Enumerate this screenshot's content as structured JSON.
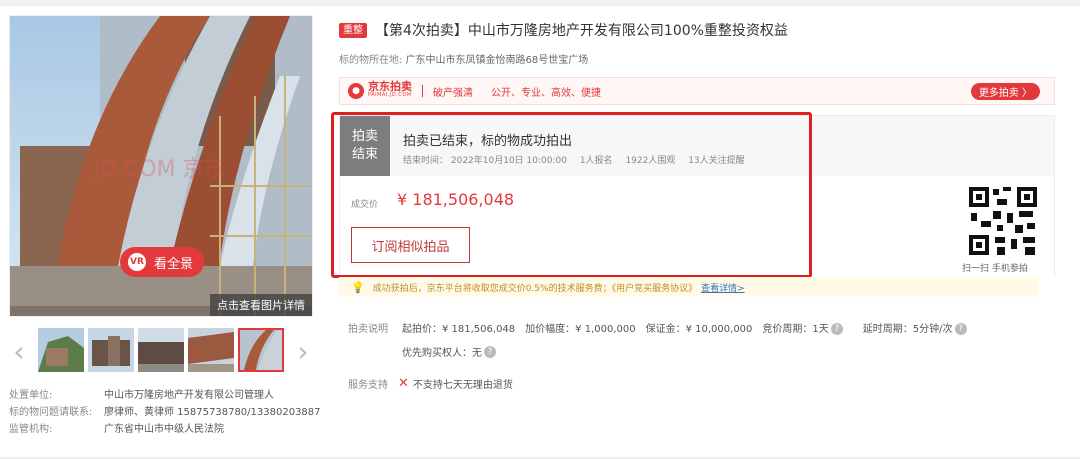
{
  "colors": {
    "accent": "#e4393c",
    "highlight": "#e02020",
    "notice_bg": "#fffbe6",
    "link": "#3a6ec9"
  },
  "gallery": {
    "pano_label": "看全景",
    "pano_icon": "VR",
    "detail_link": "点击查看图片详情",
    "watermark": "JD.COM 京东",
    "prev_icon": "‹",
    "next_icon": "›"
  },
  "org": [
    {
      "key": "处置单位:",
      "value": "中山市万隆房地产开发有限公司管理人"
    },
    {
      "key": "标的物问题请联系:",
      "value": "廖律师、黄律师 15875738780/13380203887"
    },
    {
      "key": "监管机构:",
      "value": "广东省中山市中级人民法院"
    }
  ],
  "header": {
    "badge": "重整",
    "title": "【第4次拍卖】中山市万隆房地产开发有限公司100%重整投资权益",
    "location_label": "标的物所在地:",
    "location_value": "广东中山市东凤镇金怡南路68号世宝广场"
  },
  "brand": {
    "logo_main": "京东拍卖",
    "logo_sub": "PAIMAI.JD.COM",
    "tag": "破产强清",
    "slogan": "公开、专业、高效、便捷",
    "more_label": "更多拍卖 〉"
  },
  "status": {
    "tag_line1": "拍卖",
    "tag_line2": "结束",
    "main": "拍卖已结束，标的物成功拍出",
    "end_time": "结束时间： 2022年10月10日 10:00:00",
    "signups": "1人报名",
    "views": "1922人围观",
    "watchers": "13人关注提醒",
    "price_label": "成交价",
    "price": "¥ 181,506,048",
    "subscribe_label": "订阅相似拍品",
    "qr_caption": "扫一扫 手机参拍"
  },
  "notice": {
    "text": "成功获拍后，京东平台将收取您成交价0.5%的技术服务费；《用户竞买服务协议》",
    "link": "查看详情>"
  },
  "params": {
    "label": "拍卖说明",
    "start_price": "起拍价：¥ 181,506,048",
    "increment": "加价幅度：¥ 1,000,000",
    "deposit": "保证金：¥ 10,000,000",
    "period": "竞价周期：1天",
    "delay": "延时周期：5分钟/次",
    "priority": "优先购买权人：无",
    "help_icon": "?"
  },
  "service": {
    "label": "服务支持",
    "icon": "✕",
    "text": "不支持七天无理由退货"
  }
}
